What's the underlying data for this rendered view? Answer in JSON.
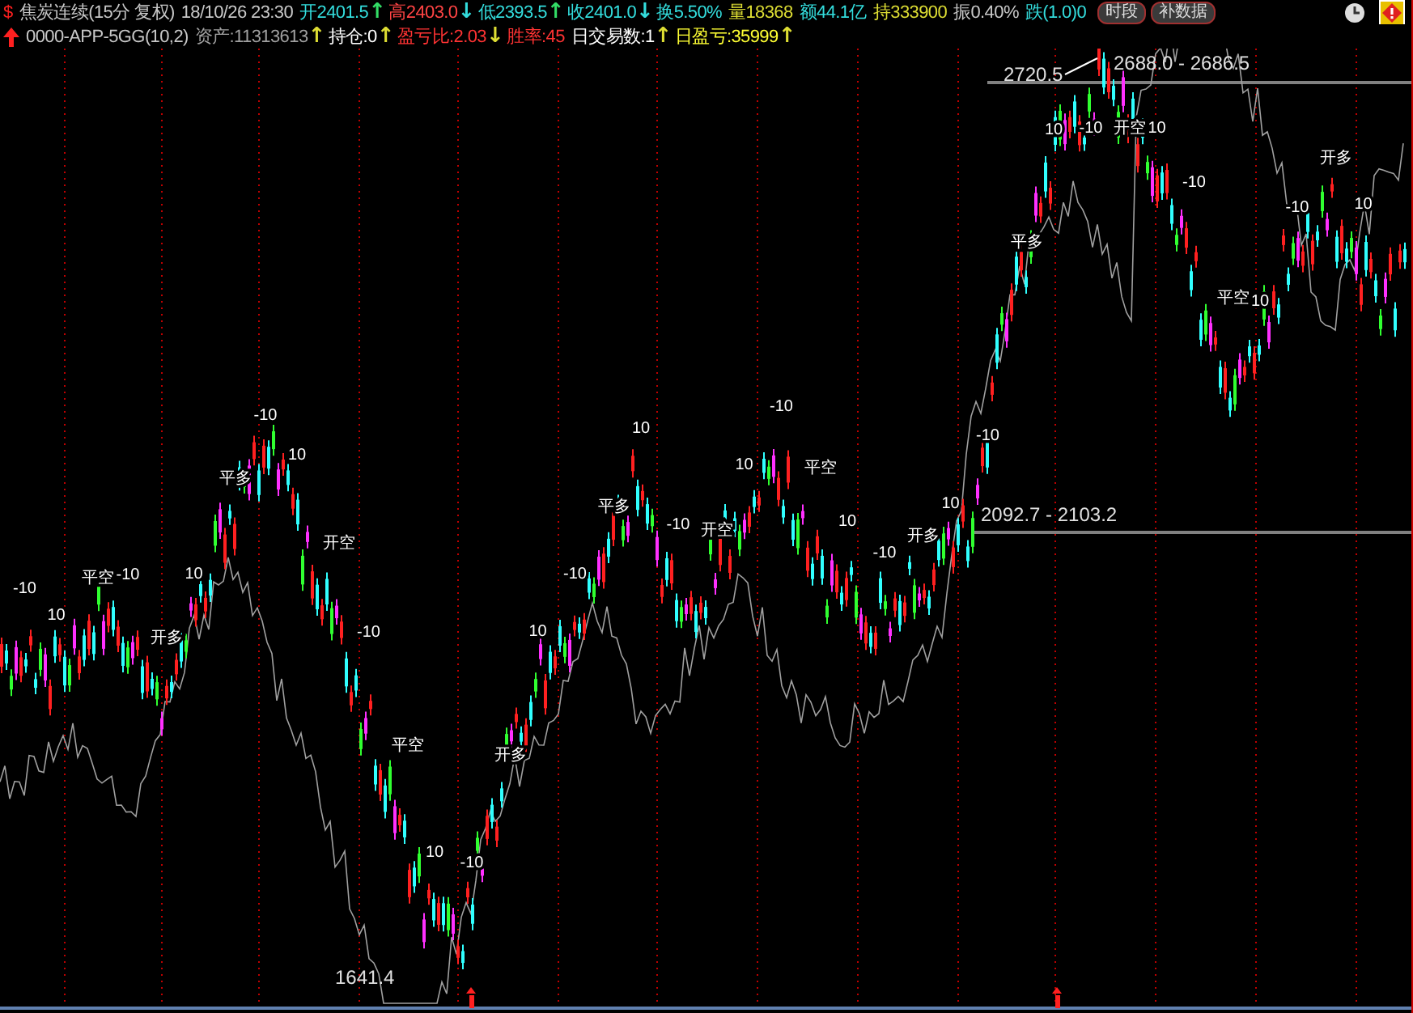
{
  "title_bar": {
    "icon_glyph": "$",
    "symbol": "焦炭连续(15分 复权)",
    "datetime": "18/10/26 23:30",
    "quotes": [
      {
        "text": "开2401.5",
        "color": "#33dddd",
        "arrow": {
          "glyph": "↑",
          "color": "#33dd66"
        }
      },
      {
        "text": "高2403.0",
        "color": "#ff4444",
        "arrow": {
          "glyph": "↓",
          "color": "#33dddd"
        }
      },
      {
        "text": "低2393.5",
        "color": "#33dddd",
        "arrow": {
          "glyph": "↑",
          "color": "#33dd66"
        }
      },
      {
        "text": "收2401.0",
        "color": "#33dddd",
        "arrow": {
          "glyph": "↓",
          "color": "#33dddd"
        }
      },
      {
        "text": "换5.50%",
        "color": "#33dddd"
      },
      {
        "text": "量18368",
        "color": "#dddd33"
      },
      {
        "text": "额44.1亿",
        "color": "#33dddd"
      },
      {
        "text": "持333900",
        "color": "#dddd33"
      },
      {
        "text": "振0.40%",
        "color": "#c8c8c8"
      },
      {
        "text": "跌(1.0)0",
        "color": "#33dddd"
      }
    ],
    "buttons": [
      "时段",
      "补数据"
    ]
  },
  "strategy_bar": {
    "name": "0000-APP-5GG(10,2)",
    "stats": [
      {
        "text": "资产:11313613",
        "color": "#a0a0a0",
        "arrow": {
          "glyph": "↑",
          "color": "#dddd33"
        }
      },
      {
        "text": "持仓:0",
        "color": "#ffffff",
        "arrow": {
          "glyph": "↑",
          "color": "#dddd33"
        }
      },
      {
        "text": "盈亏比:2.03",
        "color": "#ff3333",
        "arrow": {
          "glyph": "↓",
          "color": "#dddd33"
        }
      },
      {
        "text": "胜率:45",
        "color": "#ff3333"
      },
      {
        "text": "日交易数:1",
        "color": "#ffffff",
        "arrow": {
          "glyph": "↑",
          "color": "#dddd33"
        }
      },
      {
        "text": "日盈亏:35999",
        "color": "#ffff33",
        "arrow": {
          "glyph": "↑",
          "color": "#dddd33"
        }
      }
    ]
  },
  "chart": {
    "high_label": "2720.5",
    "high_range": "2688.0 - 2686.5",
    "mid_range": "2092.7 - 2103.2",
    "low_label": "1641.4",
    "signals": [
      "-10",
      "10",
      "平空",
      "-10",
      "开多",
      "10",
      "平多",
      "-10",
      "10",
      "开空",
      "-10",
      "平空",
      "10",
      "-10",
      "开多",
      "10",
      "-10",
      "平多",
      "10",
      "-10",
      "开空",
      "10",
      "-10",
      "平空",
      "10",
      "-10",
      "开多",
      "10",
      "-10",
      "平多",
      "10",
      "-10",
      "开空",
      "10",
      "-10",
      "平空",
      "10",
      "-10",
      "开多",
      "10"
    ]
  }
}
